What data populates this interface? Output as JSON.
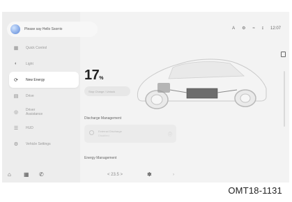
{
  "voice_assistant": {
    "prompt": "Please say Hello Ssorrio"
  },
  "status_bar": {
    "items": [
      "A",
      "⚙",
      "≈",
      "ɪ",
      "12:07"
    ]
  },
  "sidebar": {
    "items": [
      {
        "label": "Quick Control",
        "icon": "grid-icon",
        "active": false
      },
      {
        "label": "Light",
        "icon": "light-icon",
        "active": false
      },
      {
        "label": "New Energy",
        "icon": "energy-icon",
        "active": true
      },
      {
        "label": "Drive",
        "icon": "drive-icon",
        "active": false
      },
      {
        "label": "Driver Assistance",
        "icon": "driver-assist-icon",
        "active": false
      },
      {
        "label": "HUD",
        "icon": "hud-icon",
        "active": false
      },
      {
        "label": "Vehicle Settings",
        "icon": "vehicle-settings-icon",
        "active": false
      }
    ]
  },
  "battery": {
    "value": "17",
    "unit": "%"
  },
  "charge_button": {
    "label": "Stop Charge / Unlock"
  },
  "sections": {
    "discharge": "Discharge Management",
    "energy": "Energy Management"
  },
  "discharge_card": {
    "title": "External Discharge",
    "subtitle": "Disabled"
  },
  "climate": {
    "temperature": "< 23.5 >"
  },
  "caption": "OMT18-1131"
}
